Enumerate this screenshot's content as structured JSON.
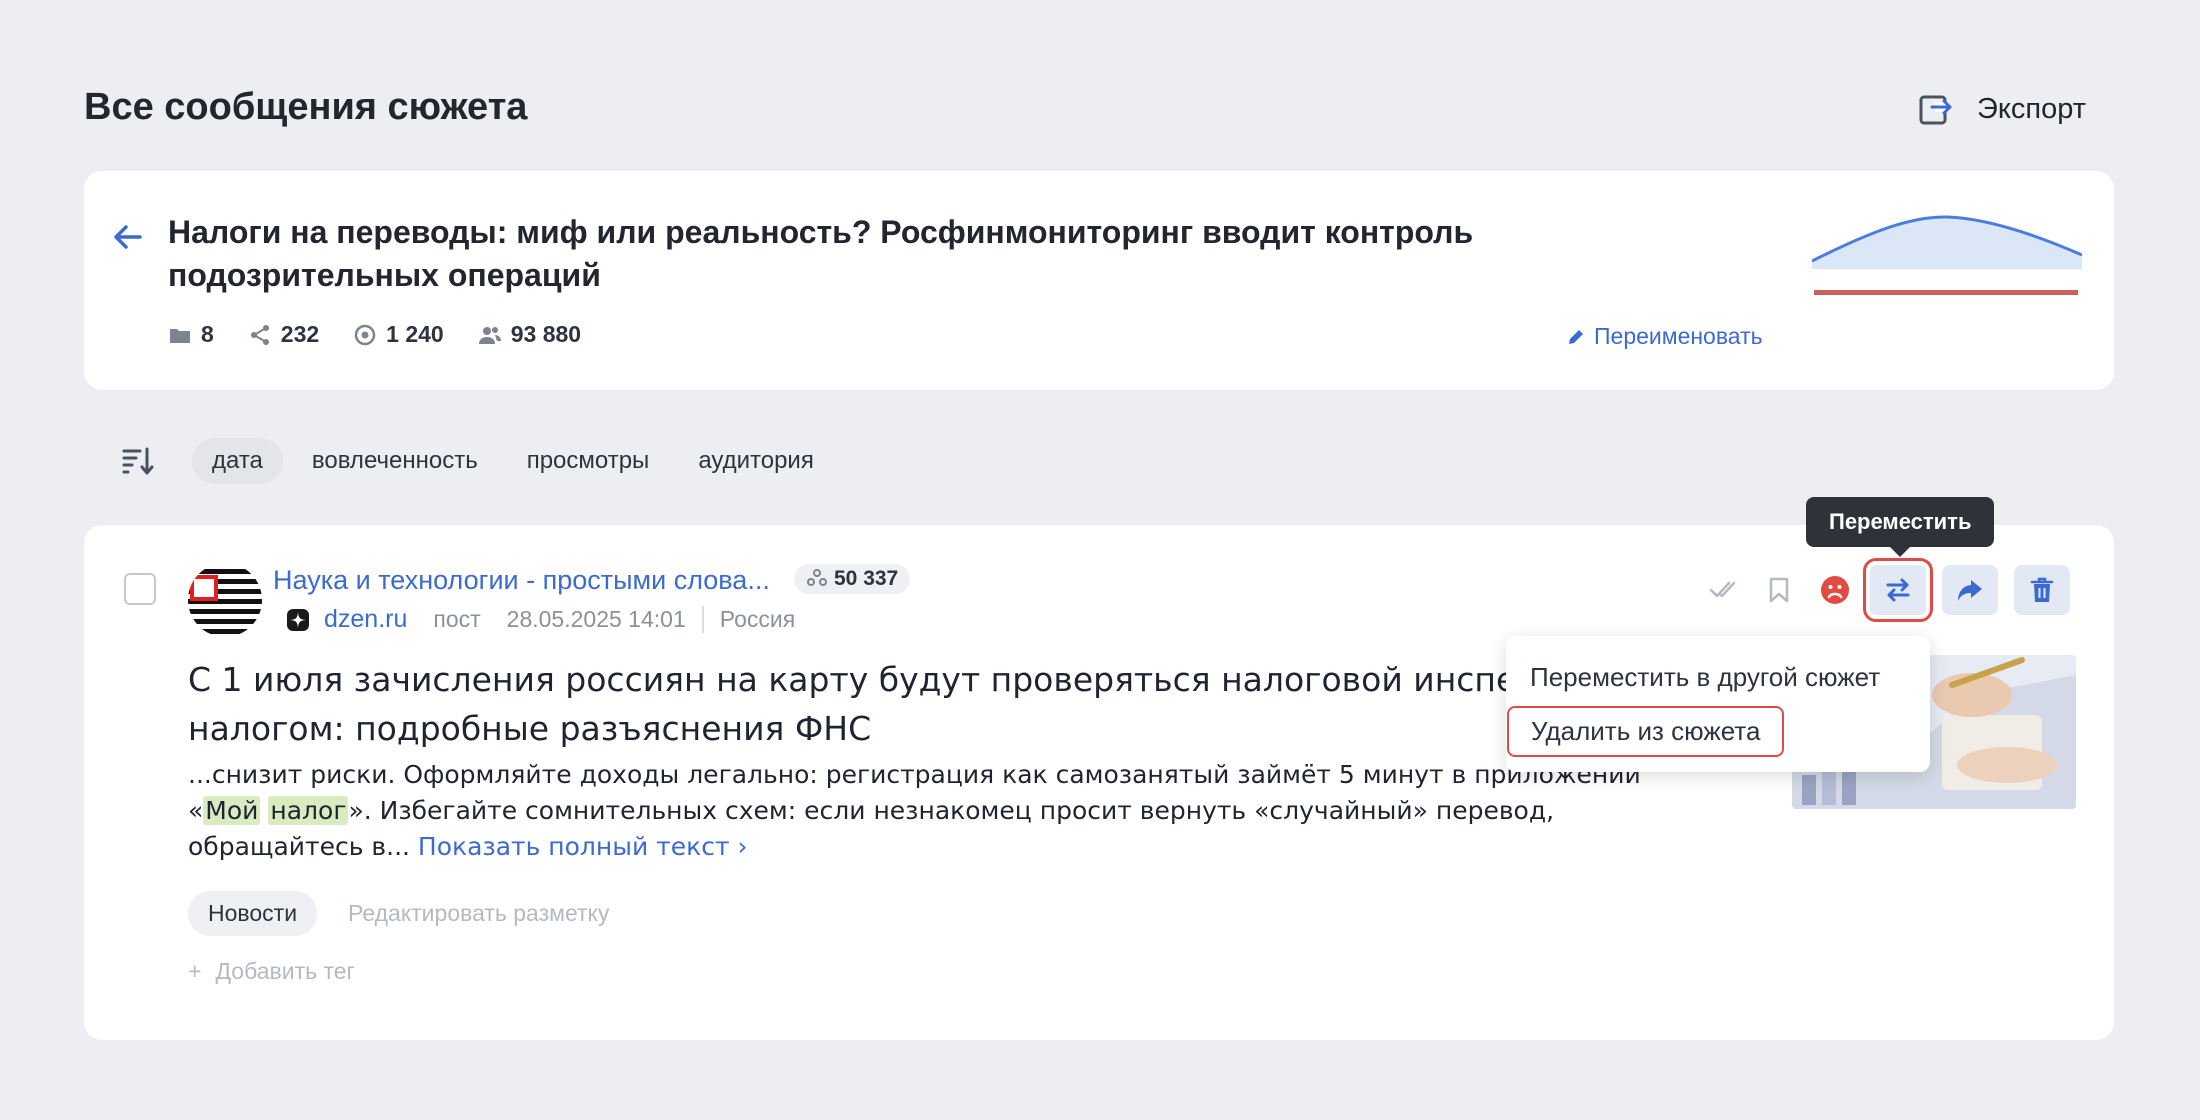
{
  "page": {
    "title": "Все сообщения сюжета",
    "export_label": "Экспорт"
  },
  "story": {
    "title": "Налоги на переводы: миф или реальность? Росфинмониторинг вводит контроль подозрительных операций",
    "stats": {
      "messages": "8",
      "shares": "232",
      "views": "1 240",
      "audience": "93 880"
    },
    "rename_label": "Переименовать",
    "sparkline_colors": {
      "area": "#dbe6f7",
      "line": "#4a7de0",
      "bar": "#c9615a"
    }
  },
  "sort": {
    "options": [
      "дата",
      "вовлеченность",
      "просмотры",
      "аудитория"
    ],
    "active": "дата"
  },
  "post": {
    "source_name": "Наука и технологии - простыми слова...",
    "subscribers": "50 337",
    "site": "dzen.ru",
    "type": "пост",
    "date": "28.05.2025 14:01",
    "region": "Россия",
    "title": "С 1 июля зачисления россиян на карту будут проверяться налоговой инспекцией налогом: подробные разъяснения ФНС",
    "excerpt_part1": "...снизит риски. Оформляйте доходы легально: регистрация как самозанятый займёт 5 минут в приложении «",
    "highlight1": "Мой",
    "highlight2": "налог",
    "excerpt_part2": "». Избегайте сомнительных схем: если незнакомец просит вернуть «случайный» перевод, обращайтесь в... ",
    "show_full_label": "Показать полный текст",
    "tag": "Новости",
    "edit_markup_label": "Редактировать разметку",
    "add_tag_label": "Добавить тег"
  },
  "actions": {
    "tooltip": "Переместить",
    "menu": [
      "Переместить в другой сюжет",
      "Удалить из сюжета"
    ]
  },
  "colors": {
    "accent": "#3c6ad1",
    "highlight_red": "#e24b43",
    "negative": "#e24b43"
  }
}
